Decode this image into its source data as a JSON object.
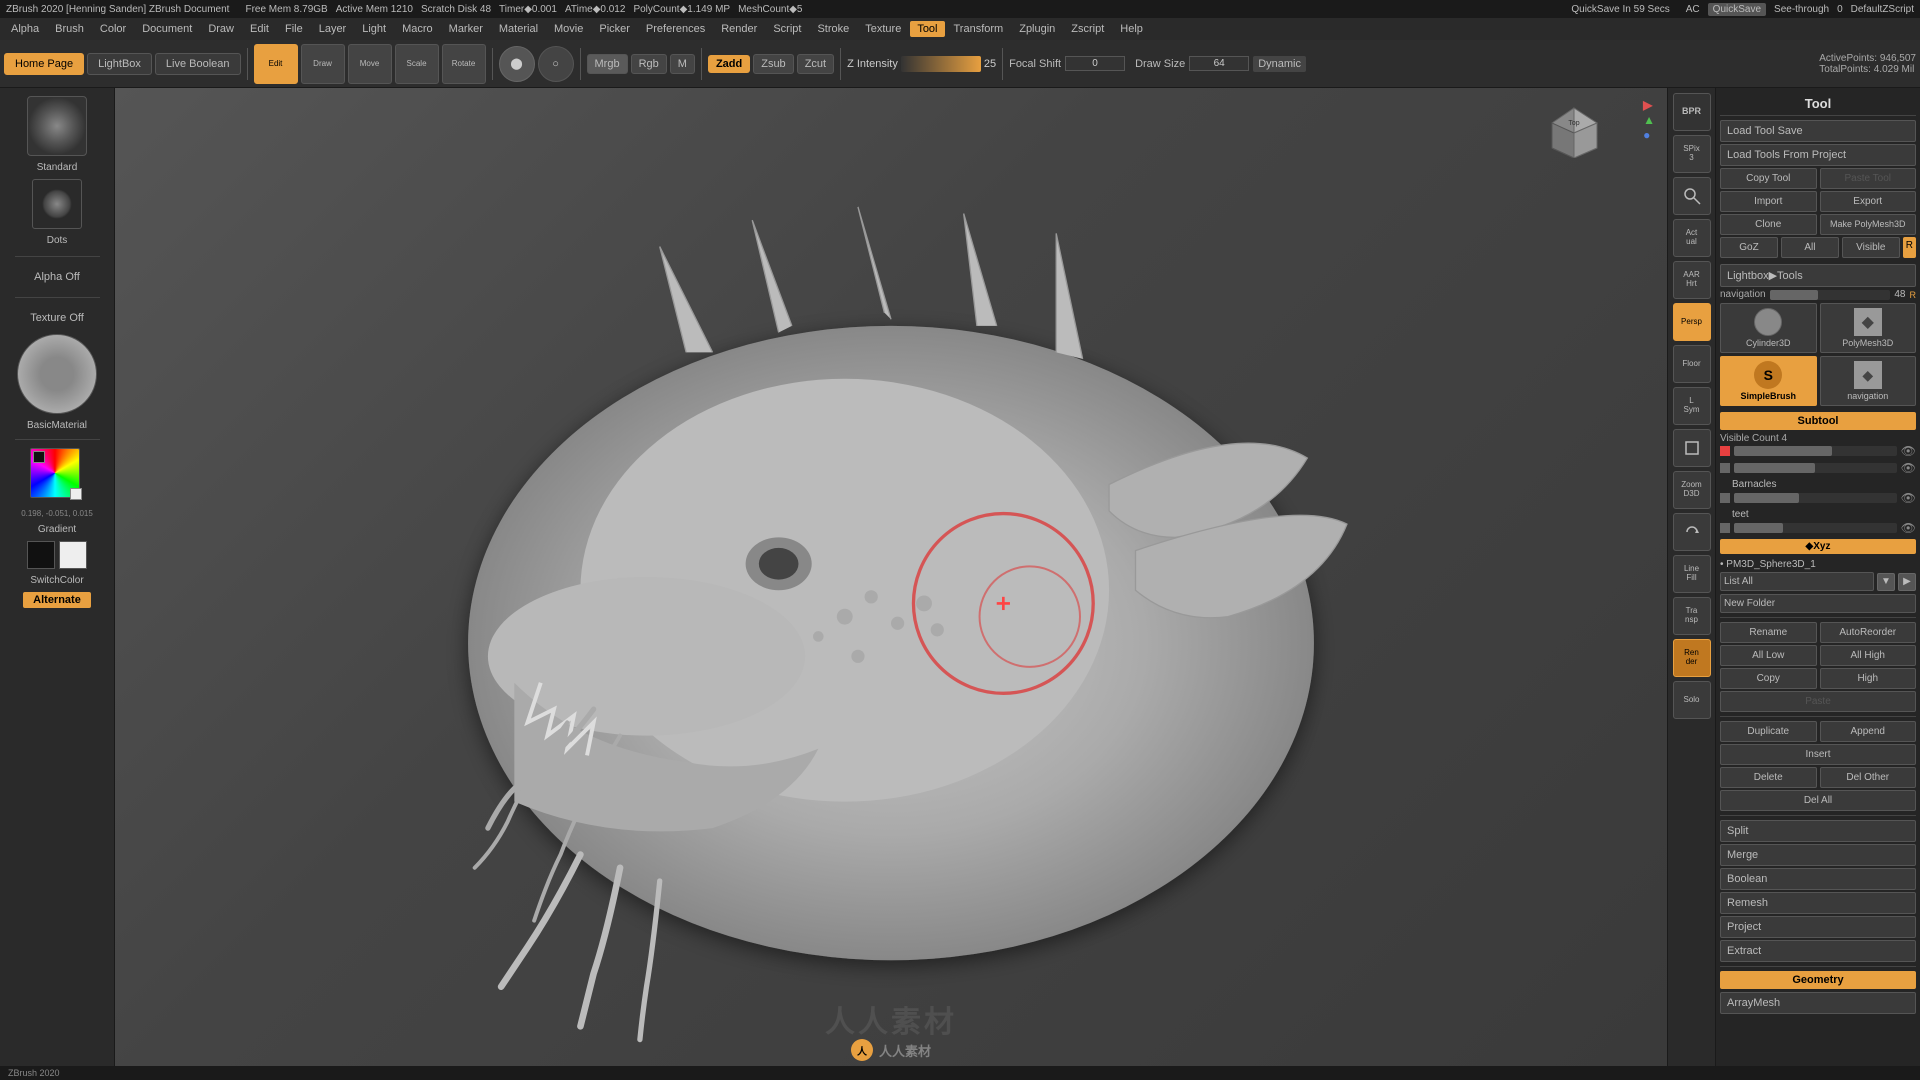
{
  "app": {
    "title": "ZBrush 2020 [Henning Sanden]  ZBrush Document",
    "mem_free": "Free Mem 8.79GB",
    "mem_active": "Active Mem 1210",
    "scratch": "Scratch Disk 48",
    "timer": "Timer◆0.001",
    "atime": "ATime◆0.012",
    "polycount": "PolyCount◆1.149 MP",
    "meshcount": "MeshCount◆5",
    "quicksave": "QuickSave In 59 Secs",
    "ac_label": "AC",
    "quicksave_btn": "QuickSave",
    "seethrough": "See-through",
    "seethrough_val": "0",
    "default_zscript": "DefaultZScript"
  },
  "menu": {
    "items": [
      "Alpha",
      "Brush",
      "Color",
      "Document",
      "Draw",
      "Edit",
      "File",
      "Layer",
      "Light",
      "Macro",
      "Marker",
      "Material",
      "Movie",
      "Picker",
      "Preferences",
      "Render",
      "Script",
      "Stroke",
      "Texture",
      "Tool",
      "Transform",
      "Zplugin",
      "Zscript",
      "Help"
    ]
  },
  "tabs": {
    "home": "Home Page",
    "lightbox": "LightBox",
    "live_boolean": "Live Boolean"
  },
  "toolbar": {
    "edit": "Edit",
    "draw": "Draw",
    "move": "Move",
    "scale": "Scale",
    "rotate": "Rotate",
    "mrgb_label": "Mrgb",
    "rgb_label": "Rgb",
    "m_label": "M",
    "zadd_label": "Zadd",
    "zsub_label": "Zsub",
    "zcut_label": "Zcut",
    "focal_shift": "Focal Shift",
    "focal_shift_val": "0",
    "draw_size_label": "Draw Size",
    "draw_size_val": "64",
    "dynamic_label": "Dynamic",
    "z_intensity_label": "Z Intensity",
    "z_intensity_val": "25",
    "active_points": "ActivePoints: 946,507",
    "total_points": "TotalPoints: 4.029 Mil"
  },
  "left_panel": {
    "brush_label": "Standard",
    "dots_label": "Dots",
    "alpha_label": "Alpha Off",
    "texture_label": "Texture Off",
    "material_label": "BasicMaterial",
    "gradient_label": "Gradient",
    "switch_color_label": "SwitchColor",
    "alternate_label": "Alternate",
    "color_value": "0.198, -0.051, 0.015"
  },
  "right_icons": [
    {
      "name": "BPR",
      "label": "BPR"
    },
    {
      "name": "SPix",
      "label": "SPix 3"
    },
    {
      "name": "Zoom",
      "label": "Zoom"
    },
    {
      "name": "Actual",
      "label": "Actual"
    },
    {
      "name": "AARHrt",
      "label": "AARHrt"
    },
    {
      "name": "Persp",
      "label": "Persp",
      "active": true
    },
    {
      "name": "Floor",
      "label": "Floor"
    },
    {
      "name": "LSym",
      "label": "L.Sym"
    },
    {
      "name": "Frame",
      "label": "Frame"
    },
    {
      "name": "ZoomD3D",
      "label": "ZoomD3D"
    },
    {
      "name": "Rotate",
      "label": "Rotate"
    },
    {
      "name": "LineFill",
      "label": "Line Fill"
    },
    {
      "name": "Transp",
      "label": "Transp"
    },
    {
      "name": "Render2",
      "label": "Render"
    },
    {
      "name": "Solo",
      "label": "Solo"
    }
  ],
  "tool_panel": {
    "title": "Tool",
    "load_tool_save": "Load Tool Save",
    "load_tools_from_project": "Load Tools From Project",
    "copy_tool": "Copy Tool",
    "paste_tool": "Paste Tool",
    "import": "Import",
    "export": "Export",
    "clone": "Clone",
    "make_polymesh3d": "Make PolyMesh3D",
    "goz": "GoZ",
    "all_label": "All",
    "visible_label": "Visible",
    "r_label": "R",
    "lightbox_tools": "Lightbox▶Tools",
    "navigation_label": "navigation",
    "navigation_val": "48",
    "r_val": "R",
    "subtool_title": "Subtool",
    "visible_count": "Visible Count 4",
    "tools": [
      {
        "name": "Cylinder3D",
        "icon": "⌀"
      },
      {
        "name": "PolyMesh3D",
        "icon": "◆"
      },
      {
        "name": "SimpleBrush",
        "icon": "S"
      },
      {
        "name": "navigation",
        "icon": "◆"
      }
    ],
    "xyz_label": "◆Xyz",
    "pm3d_label": "• PM3D_Sphere3D_1",
    "list_all": "List All",
    "new_folder": "New Folder",
    "rename": "Rename",
    "auto_reorder": "AutoReorder",
    "all_low": "All Low",
    "all_high": "All High",
    "copy": "Copy",
    "high": "High",
    "paste": "Paste",
    "duplicate": "Duplicate",
    "append": "Append",
    "insert": "Insert",
    "delete": "Delete",
    "del_other": "Del Other",
    "del_all": "Del All",
    "split": "Split",
    "merge": "Merge",
    "boolean": "Boolean",
    "remesh": "Remesh",
    "project": "Project",
    "extract": "Extract",
    "geometry_title": "Geometry",
    "array_mesh": "ArrayMesh"
  },
  "canvas": {
    "watermark": "人人素材"
  }
}
